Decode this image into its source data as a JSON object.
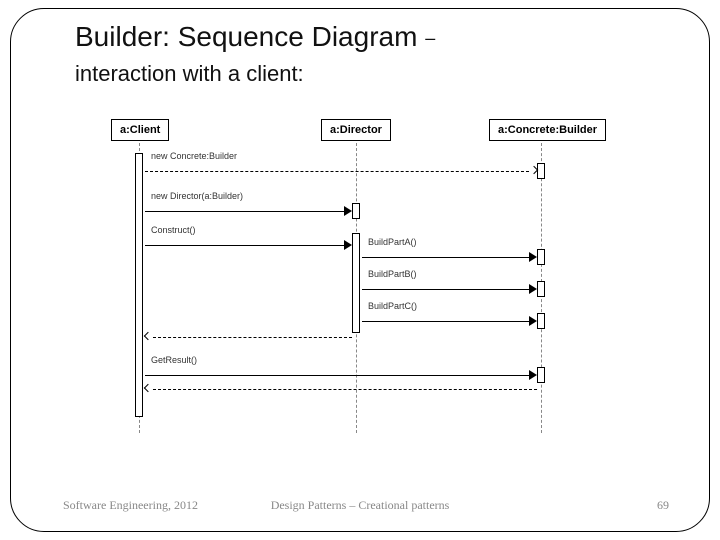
{
  "title": "Builder: Sequence Diagram",
  "title_dash": "–",
  "subtitle": "interaction with a client:",
  "lifelines": {
    "client": "a:Client",
    "director": "a:Director",
    "builder": "a:Concrete:Builder"
  },
  "messages": {
    "new_builder": "new Concrete:Builder",
    "new_director": "new Director(a:Builder)",
    "construct": "Construct()",
    "build_a": "BuildPartA()",
    "build_b": "BuildPartB()",
    "build_c": "BuildPartC()",
    "get_result": "GetResult()"
  },
  "footer": {
    "left": "Software Engineering, 2012",
    "center": "Design Patterns – Creational patterns",
    "right": "69"
  }
}
